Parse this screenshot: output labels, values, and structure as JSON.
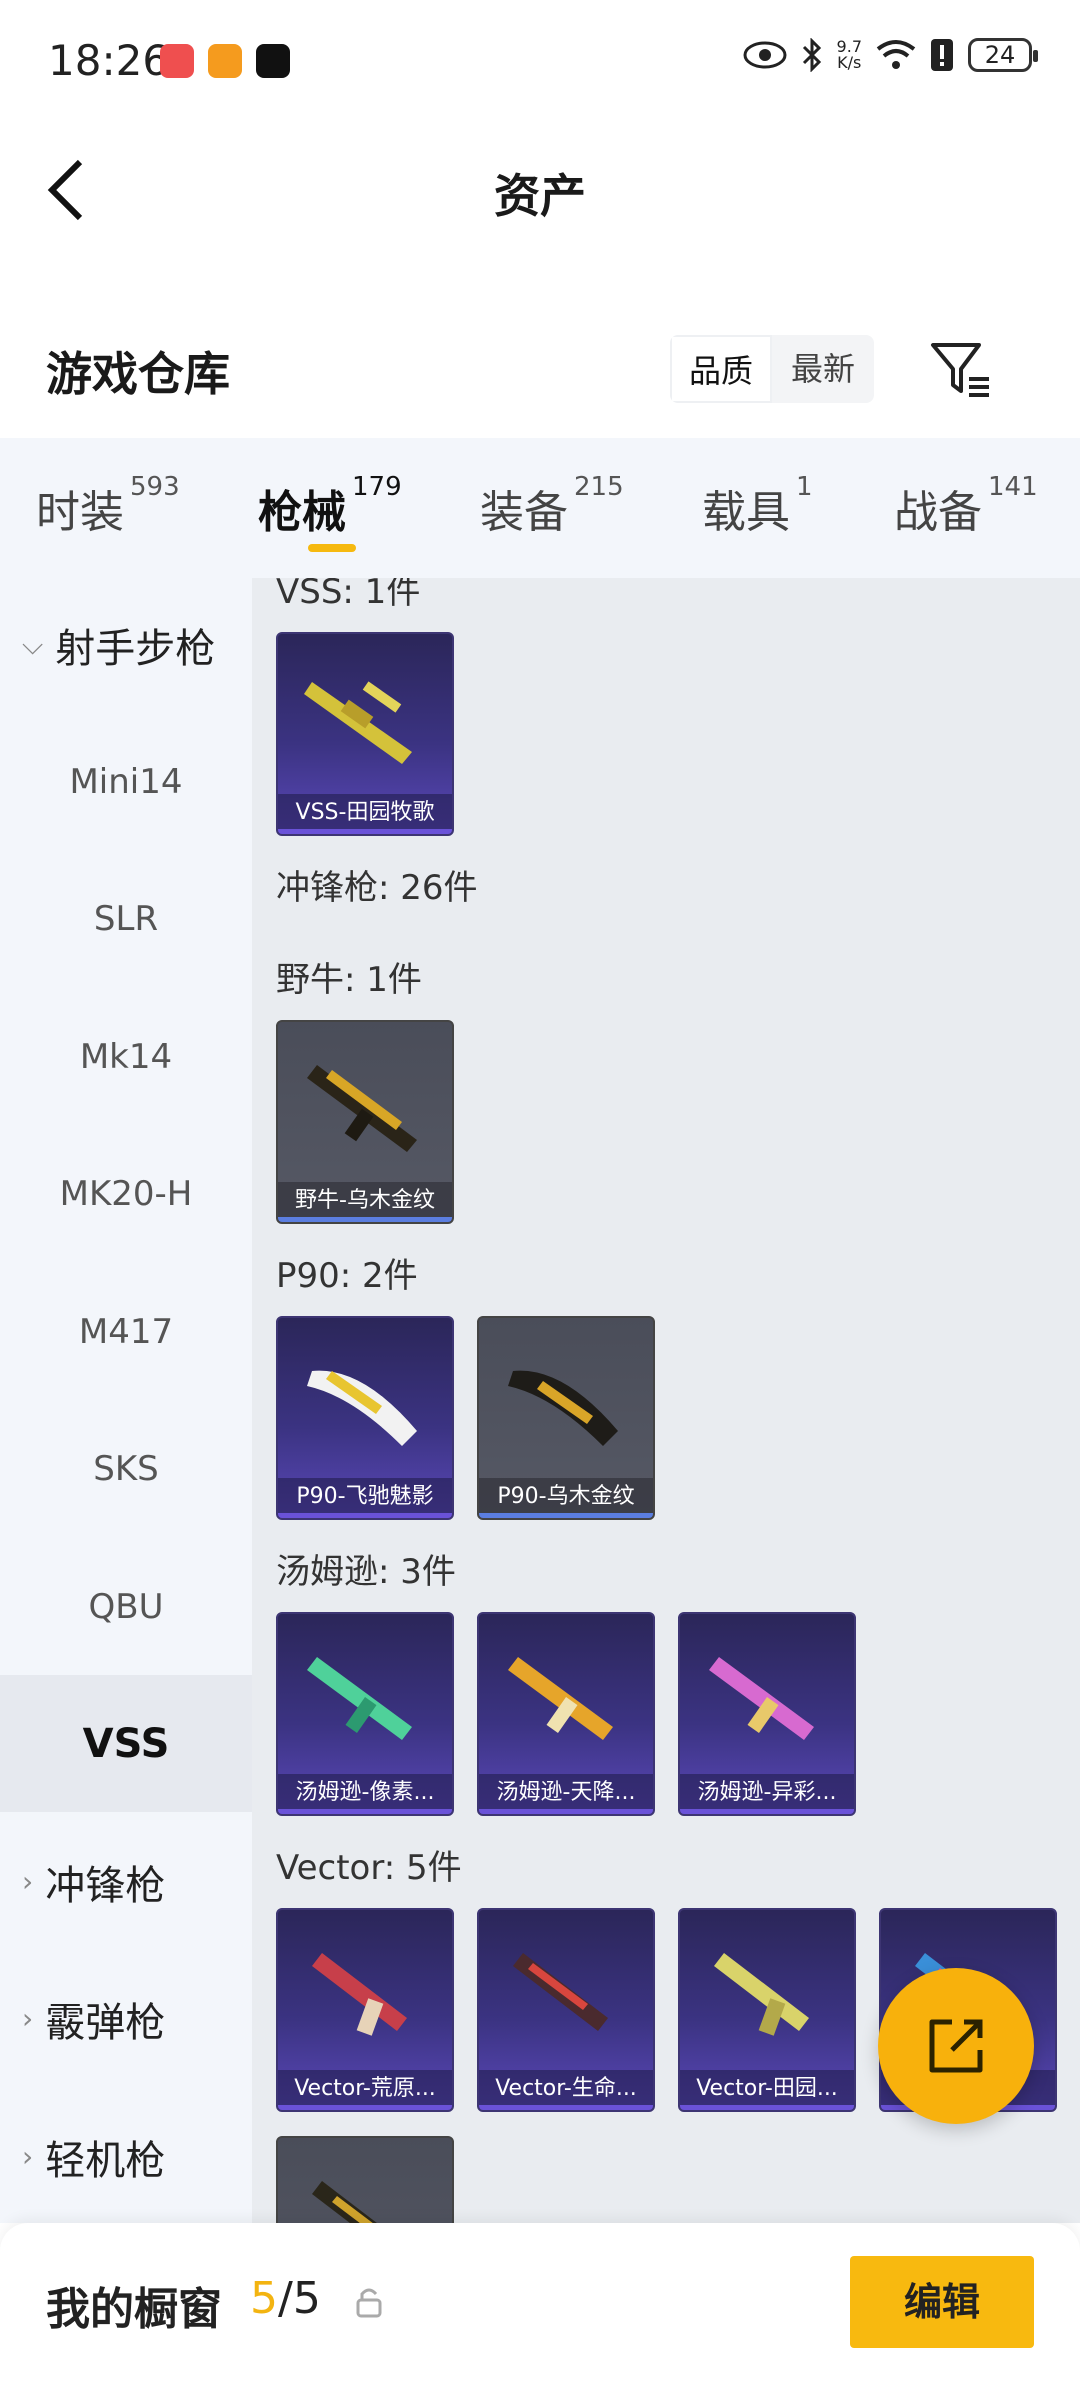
{
  "status_bar": {
    "time": "18:26",
    "net_speed_value": "9.7",
    "net_speed_unit": "K/s",
    "battery": "24"
  },
  "header": {
    "title": "资产"
  },
  "warehouse": {
    "title": "游戏仓库",
    "sort_options": [
      "品质",
      "最新"
    ],
    "sort_selected": "品质"
  },
  "tabs": [
    {
      "label": "时装",
      "count": "593"
    },
    {
      "label": "枪械",
      "count": "179",
      "active": true
    },
    {
      "label": "装备",
      "count": "215"
    },
    {
      "label": "载具",
      "count": "1"
    },
    {
      "label": "战备",
      "count": "141"
    }
  ],
  "sidebar": {
    "group_expanded": "射手步枪",
    "items": [
      "Mini14",
      "SLR",
      "Mk14",
      "MK20-H",
      "M417",
      "SKS",
      "QBU",
      "VSS"
    ],
    "active_item": "VSS",
    "groups_collapsed": [
      "冲锋枪",
      "霰弹枪",
      "轻机枪"
    ]
  },
  "content": {
    "vss_header": "VSS: 1件",
    "vss_cards": [
      "VSS-田园牧歌"
    ],
    "smg_header": "冲锋枪: 26件",
    "bizon_header": "野牛: 1件",
    "bizon_cards": [
      "野牛-乌木金纹"
    ],
    "p90_header": "P90: 2件",
    "p90_cards": [
      "P90-飞驰魅影",
      "P90-乌木金纹"
    ],
    "tommy_header": "汤姆逊: 3件",
    "tommy_cards": [
      "汤姆逊-像素...",
      "汤姆逊-天降...",
      "汤姆逊-异彩..."
    ],
    "vector_header": "Vector: 5件",
    "vector_cards": [
      "Vector-荒原...",
      "Vector-生命...",
      "Vector-田园..."
    ]
  },
  "bottom_bar": {
    "title": "我的橱窗",
    "count_current": "5",
    "count_total": "/5",
    "edit_label": "编辑"
  },
  "colors": {
    "accent": "#f8b90f",
    "card_purple": "#3b3382",
    "card_gray": "#565965",
    "sidebar_bg": "#f3f6fb",
    "content_bg": "#e9ecf0"
  }
}
